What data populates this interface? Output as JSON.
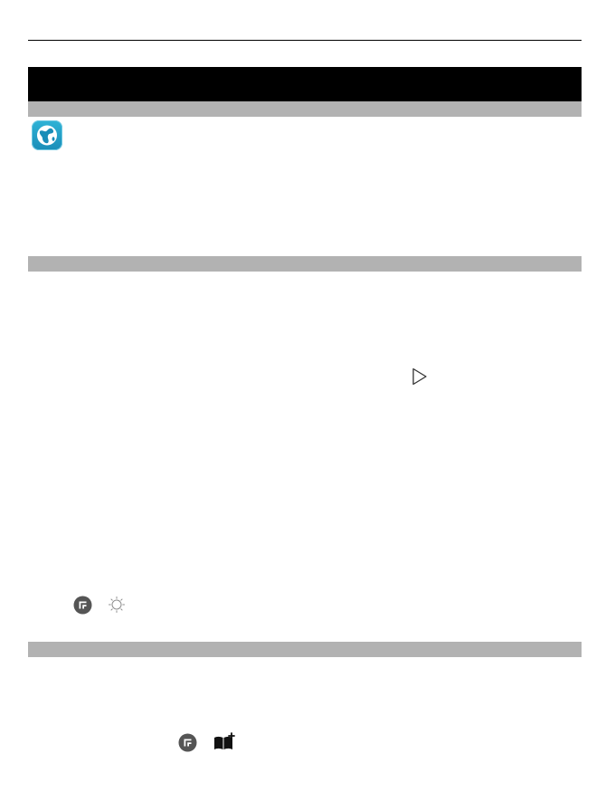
{
  "page": {
    "header_rule": "",
    "sections": [
      {
        "title": ""
      },
      {
        "title": ""
      },
      {
        "title": ""
      }
    ]
  },
  "icons": {
    "app": "browser-globe-icon",
    "play": "play-icon",
    "options_1": "options-menu-icon",
    "brightness": "brightness-icon",
    "options_2": "options-menu-icon",
    "bookmark_add": "add-bookmark-icon"
  },
  "colors": {
    "header_bar": "#000000",
    "section_bar": "#b2b2b2",
    "app_icon": "#1a8db8",
    "options_icon": "#555555"
  }
}
